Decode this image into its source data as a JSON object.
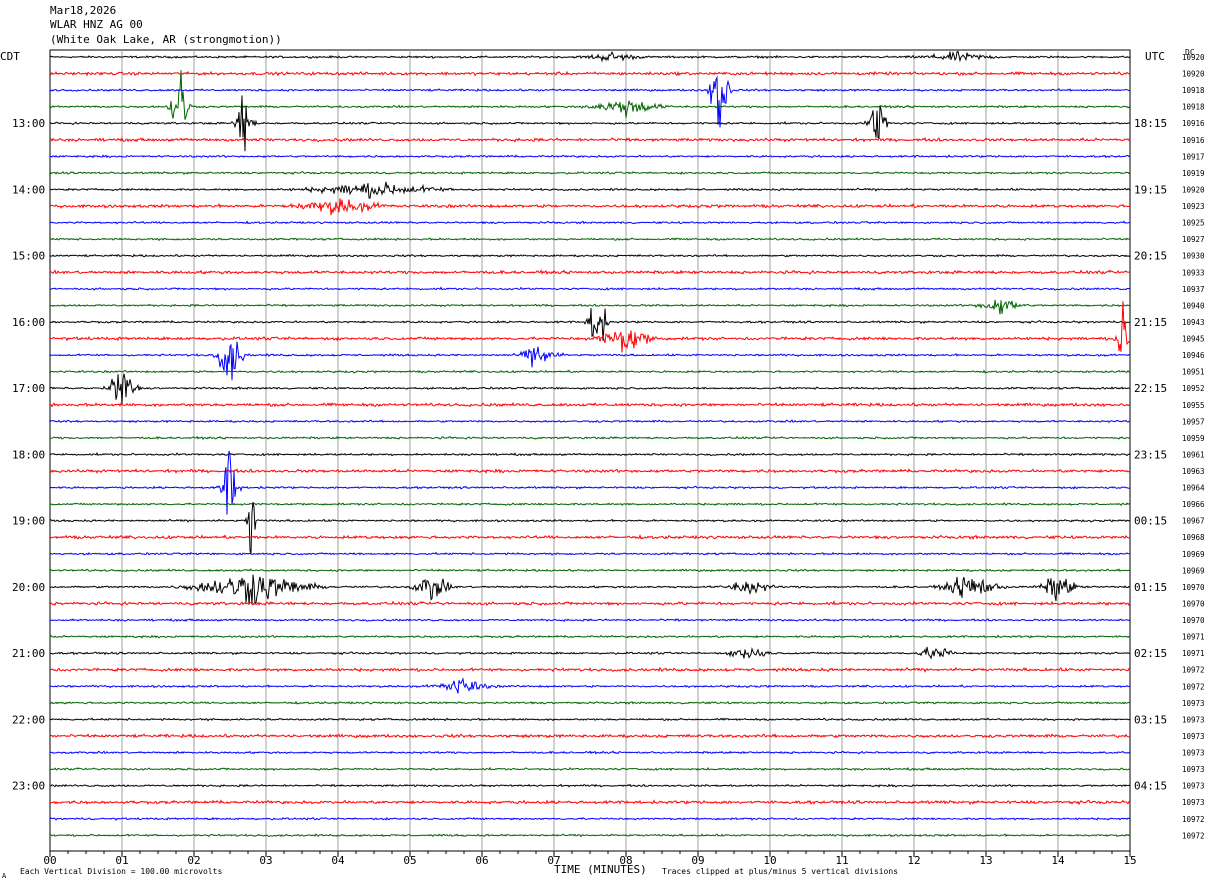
{
  "header": {
    "date": "Mar18,2026",
    "station": "WLAR HNZ AG 00",
    "location": "(White Oak Lake, AR (strongmotion))"
  },
  "left_tz": "CDT",
  "right_tz": "UTC",
  "dc_label": "DC",
  "footer": {
    "left": "Each Vertical Division =  100.00 microvolts",
    "center": "TIME (MINUTES)",
    "right": "Traces clipped at plus/minus 5 vertical divisions",
    "corner": "A"
  },
  "colors": {
    "trace_cycle": [
      "#000000",
      "#ff0000",
      "#0000ff",
      "#006400"
    ],
    "grid": "#a0a0a0"
  },
  "chart_data": {
    "type": "line",
    "title": "WLAR HNZ AG 00 (White Oak Lake, AR (strongmotion))",
    "xlabel": "TIME (MINUTES)",
    "ylabel": "",
    "x_ticks": [
      "00",
      "01",
      "02",
      "03",
      "04",
      "05",
      "06",
      "07",
      "08",
      "09",
      "10",
      "11",
      "12",
      "13",
      "14",
      "15"
    ],
    "xlim": [
      0,
      15
    ],
    "trace_minutes_per_line": 15,
    "num_traces": 48,
    "left_labels": [
      {
        "trace": 4,
        "text": "13:00"
      },
      {
        "trace": 8,
        "text": "14:00"
      },
      {
        "trace": 12,
        "text": "15:00"
      },
      {
        "trace": 16,
        "text": "16:00"
      },
      {
        "trace": 20,
        "text": "17:00"
      },
      {
        "trace": 24,
        "text": "18:00"
      },
      {
        "trace": 28,
        "text": "19:00"
      },
      {
        "trace": 32,
        "text": "20:00"
      },
      {
        "trace": 36,
        "text": "21:00"
      },
      {
        "trace": 40,
        "text": "22:00"
      },
      {
        "trace": 44,
        "text": "23:00"
      }
    ],
    "right_labels": [
      {
        "trace": 4,
        "text": "18:15"
      },
      {
        "trace": 8,
        "text": "19:15"
      },
      {
        "trace": 12,
        "text": "20:15"
      },
      {
        "trace": 16,
        "text": "21:15"
      },
      {
        "trace": 20,
        "text": "22:15"
      },
      {
        "trace": 24,
        "text": "23:15"
      },
      {
        "trace": 28,
        "text": "00:15"
      },
      {
        "trace": 32,
        "text": "01:15"
      },
      {
        "trace": 36,
        "text": "02:15"
      },
      {
        "trace": 40,
        "text": "03:15"
      },
      {
        "trace": 44,
        "text": "04:15"
      }
    ],
    "dc_offsets": [
      "10920",
      "10920",
      "10918",
      "10918",
      "10916",
      "10916",
      "10917",
      "10919",
      "10920",
      "10923",
      "10925",
      "10927",
      "10930",
      "10933",
      "10937",
      "10940",
      "10943",
      "10945",
      "10946",
      "10951",
      "10952",
      "10955",
      "10957",
      "10959",
      "10961",
      "10963",
      "10964",
      "10966",
      "10967",
      "10968",
      "10969",
      "10969",
      "10970",
      "10970",
      "10970",
      "10971",
      "10971",
      "10972",
      "10972",
      "10973",
      "10973",
      "10973",
      "10973",
      "10973",
      "10973",
      "10973",
      "10972",
      "10972"
    ],
    "events": [
      {
        "trace": 0,
        "minute": 7.8,
        "amp": 0.3,
        "dur": 0.6
      },
      {
        "trace": 0,
        "minute": 12.6,
        "amp": 0.3,
        "dur": 0.8
      },
      {
        "trace": 3,
        "minute": 1.8,
        "amp": 4.0,
        "dur": 0.2
      },
      {
        "trace": 4,
        "minute": 2.7,
        "amp": 2.5,
        "dur": 0.2
      },
      {
        "trace": 2,
        "minute": 9.3,
        "amp": 5.0,
        "dur": 0.2
      },
      {
        "trace": 4,
        "minute": 11.5,
        "amp": 2.5,
        "dur": 0.2
      },
      {
        "trace": 3,
        "minute": 8.0,
        "amp": 0.6,
        "dur": 0.8
      },
      {
        "trace": 8,
        "minute": 4.5,
        "amp": 0.5,
        "dur": 1.5
      },
      {
        "trace": 9,
        "minute": 4.0,
        "amp": 0.5,
        "dur": 1.0
      },
      {
        "trace": 16,
        "minute": 7.6,
        "amp": 3.0,
        "dur": 0.2
      },
      {
        "trace": 17,
        "minute": 8.0,
        "amp": 1.0,
        "dur": 0.6
      },
      {
        "trace": 17,
        "minute": 14.9,
        "amp": 3.0,
        "dur": 0.15
      },
      {
        "trace": 18,
        "minute": 2.5,
        "amp": 2.0,
        "dur": 0.3
      },
      {
        "trace": 18,
        "minute": 6.8,
        "amp": 1.0,
        "dur": 0.4
      },
      {
        "trace": 20,
        "minute": 1.0,
        "amp": 2.0,
        "dur": 0.3
      },
      {
        "trace": 15,
        "minute": 13.2,
        "amp": 0.6,
        "dur": 0.5
      },
      {
        "trace": 26,
        "minute": 2.5,
        "amp": 3.0,
        "dur": 0.2
      },
      {
        "trace": 28,
        "minute": 2.8,
        "amp": 4.0,
        "dur": 0.1
      },
      {
        "trace": 32,
        "minute": 2.8,
        "amp": 1.2,
        "dur": 1.3
      },
      {
        "trace": 32,
        "minute": 5.3,
        "amp": 1.0,
        "dur": 0.4
      },
      {
        "trace": 32,
        "minute": 12.8,
        "amp": 1.0,
        "dur": 0.6
      },
      {
        "trace": 32,
        "minute": 14.0,
        "amp": 1.0,
        "dur": 0.4
      },
      {
        "trace": 32,
        "minute": 9.7,
        "amp": 0.6,
        "dur": 0.5
      },
      {
        "trace": 36,
        "minute": 9.7,
        "amp": 0.6,
        "dur": 0.4
      },
      {
        "trace": 36,
        "minute": 12.3,
        "amp": 0.6,
        "dur": 0.4
      },
      {
        "trace": 38,
        "minute": 5.7,
        "amp": 0.6,
        "dur": 0.6
      }
    ]
  }
}
